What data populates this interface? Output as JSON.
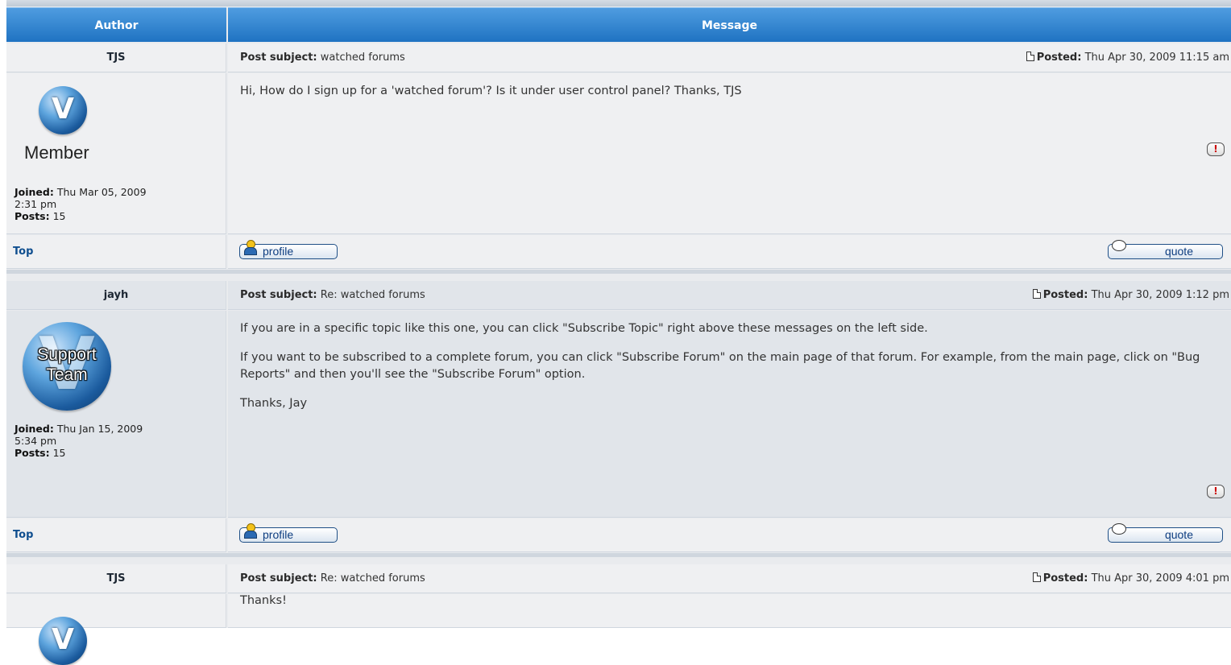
{
  "header": {
    "author": "Author",
    "message": "Message"
  },
  "labels": {
    "post_subject": "Post subject:",
    "posted": "Posted:",
    "joined": "Joined:",
    "posts": "Posts:",
    "top": "Top",
    "profile": "profile",
    "quote": "quote",
    "report_symbol": "!"
  },
  "posts": [
    {
      "author": "TJS",
      "subject": "watched forums",
      "posted": "Thu Apr 30, 2009 11:15 am",
      "rank": "Member",
      "joined_line1": "Thu Mar 05, 2009",
      "joined_line2": "2:31 pm",
      "posts": "15",
      "body": [
        "Hi, How do I sign up for a 'watched forum'? Is it under user control panel? Thanks, TJS"
      ]
    },
    {
      "author": "jayh",
      "subject": "Re: watched forums",
      "posted": "Thu Apr 30, 2009 1:12 pm",
      "rank_line1": "Support",
      "rank_line2": "Team",
      "joined_line1": "Thu Jan 15, 2009",
      "joined_line2": "5:34 pm",
      "posts": "15",
      "body": [
        "If you are in a specific topic like this one, you can click \"Subscribe Topic\" right above these messages on the left side.",
        "If you want to be subscribed to a complete forum, you can click \"Subscribe Forum\" on the main page of that forum. For example, from the main page, click on \"Bug Reports\" and then you'll see the \"Subscribe Forum\" option.",
        "Thanks, Jay"
      ]
    },
    {
      "author": "TJS",
      "subject": "Re: watched forums",
      "posted": "Thu Apr 30, 2009 4:01 pm",
      "body": [
        "Thanks!"
      ]
    }
  ]
}
